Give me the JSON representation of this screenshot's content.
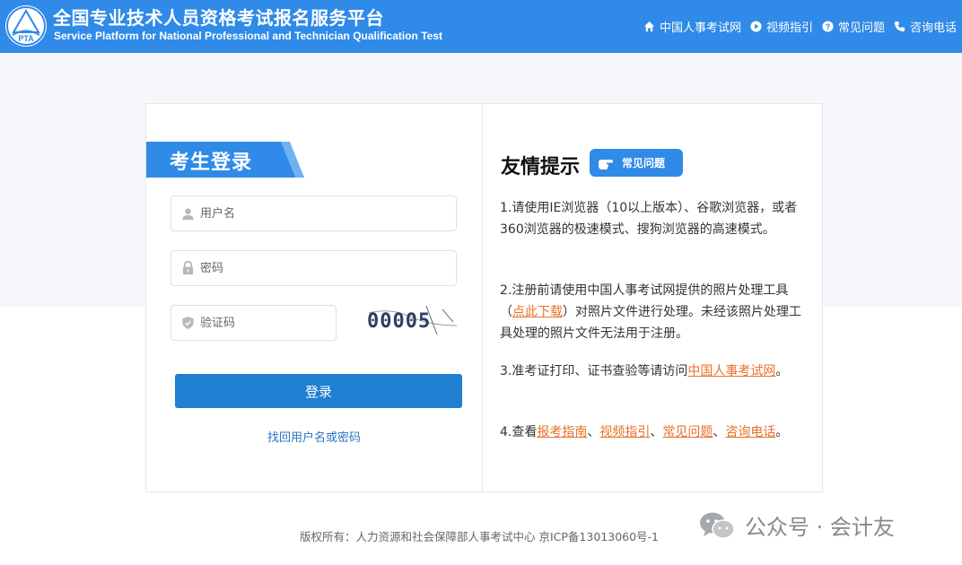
{
  "header": {
    "title": "全国专业技术人员资格考试报名服务平台",
    "subtitle": "Service Platform for National Professional and Technician Qualification Test",
    "logo_text": "PTA",
    "nav": [
      {
        "label": "中国人事考试网",
        "icon": "home-icon"
      },
      {
        "label": "视频指引",
        "icon": "play-icon"
      },
      {
        "label": "常见问题",
        "icon": "question-icon"
      },
      {
        "label": "咨询电话",
        "icon": "phone-icon"
      }
    ],
    "color": "#2f8ae8"
  },
  "login": {
    "title": "考生登录",
    "username_placeholder": "用户名",
    "password_placeholder": "密码",
    "captcha_placeholder": "验证码",
    "captcha_text": "00005",
    "submit_label": "登录",
    "recover_label": "找回用户名或密码"
  },
  "tips": {
    "title": "友情提示",
    "faq_badge": "常见问题",
    "tip1": "1.请使用IE浏览器（10以上版本）、谷歌浏览器，或者360浏览器的极速模式、搜狗浏览器的高速模式。",
    "tip2_before": "2.注册前请使用中国人事考试网提供的照片处理工具（",
    "tip2_link": "点此下载",
    "tip2_after": "）对照片文件进行处理。未经该照片处理工具处理的照片文件无法用于注册。",
    "tip3_before": "3.准考证打印、证书查验等请访问",
    "tip3_link": "中国人事考试网",
    "tip3_after": "。",
    "tip4_before": "4.查看",
    "tip4_link1": "报考指南",
    "tip4_sep1": "、",
    "tip4_link2": "视频指引",
    "tip4_sep2": "、",
    "tip4_link3": "常见问题",
    "tip4_sep3": "、",
    "tip4_link4": "咨询电话",
    "tip4_after": "。",
    "link_color": "#e8712a"
  },
  "footer": {
    "copyright": "版权所有：人力资源和社会保障部人事考试中心 京ICP备13013060号-1"
  },
  "watermark": {
    "text": "公众号 · 会计友"
  }
}
